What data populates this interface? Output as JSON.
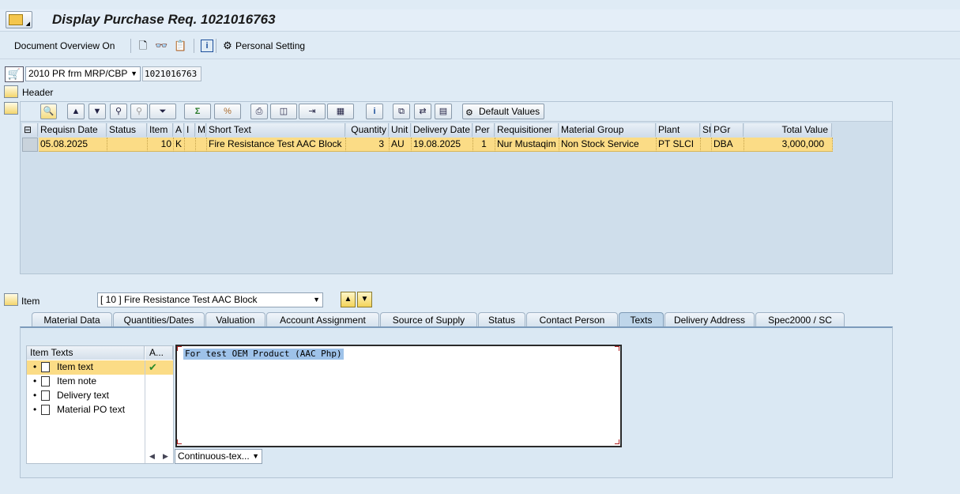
{
  "window": {
    "title": "Display Purchase Req. 1021016763"
  },
  "toolbar": {
    "document_overview": "Document Overview On",
    "personal_setting": "Personal Setting"
  },
  "header_area": {
    "doc_type": "2010 PR frm MRP/CBP",
    "pr_number": "1021016763",
    "header_label": "Header"
  },
  "grid_toolbar": {
    "default_values": "Default Values"
  },
  "table": {
    "columns": [
      "Requisn Date",
      "Status",
      "Item",
      "A",
      "I",
      "Ma",
      "Short Text",
      "Quantity",
      "Unit",
      "Delivery Date",
      "Per",
      "Requisitioner",
      "Material Group",
      "Plant",
      "St",
      "PGr",
      "Total Value"
    ],
    "rows": [
      [
        "05.08.2025",
        "",
        "10",
        "K",
        "",
        "",
        "Fire Resistance Test AAC Block",
        "3",
        "AU",
        "19.08.2025",
        "1",
        "Nur Mustaqim",
        "Non Stock Service",
        "PT SLCI",
        "",
        "DBA",
        "3,000,000"
      ]
    ]
  },
  "item_area": {
    "label": "Item",
    "selected_item": "[ 10 ] Fire Resistance Test AAC Block"
  },
  "tabs": [
    "Material Data",
    "Quantities/Dates",
    "Valuation",
    "Account Assignment",
    "Source of Supply",
    "Status",
    "Contact Person",
    "Texts",
    "Delivery Address",
    "Spec2000 / SC"
  ],
  "active_tab": "Texts",
  "texts_panel": {
    "tree_header": "Item Texts",
    "col2_header": "A...",
    "items": [
      "Item text",
      "Item note",
      "Delivery text",
      "Material PO text"
    ],
    "editor_text": "For test OEM Product (AAC Php)",
    "format_select": "Continuous-tex..."
  },
  "colors": {
    "background": "#dfebf5",
    "selected_row": "#fbdc86",
    "text_highlight": "#9ec2e9"
  }
}
